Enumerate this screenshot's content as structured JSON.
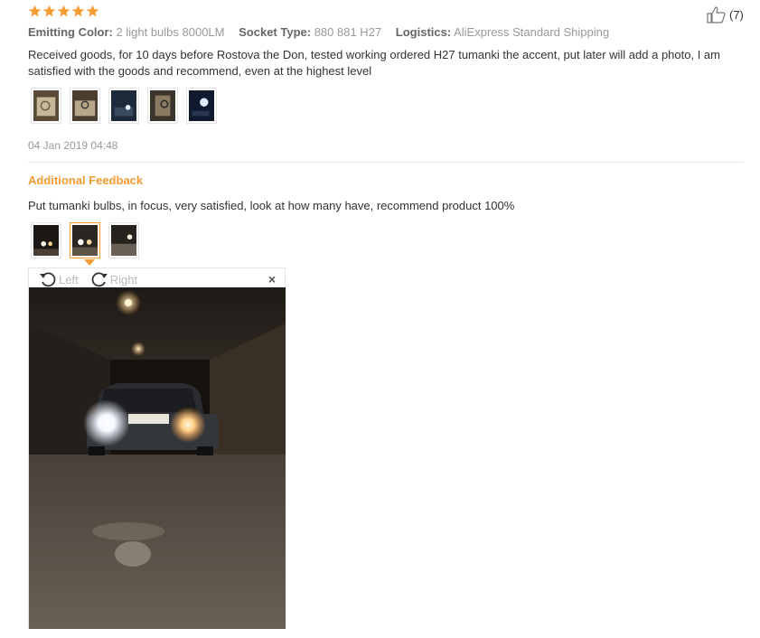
{
  "review": {
    "rating": 5,
    "meta": {
      "emitting_color_label": "Emitting Color:",
      "emitting_color_value": "2 light bulbs 8000LM",
      "socket_type_label": "Socket Type:",
      "socket_type_value": "880 881 H27",
      "logistics_label": "Logistics:",
      "logistics_value": "AliExpress Standard Shipping"
    },
    "likes": "(7)",
    "text": "Received goods, for 10 days before Rostova the Don, tested working ordered H27 tumanki the accent, put later will add a photo, I am satisfied with the goods and recommend, even at the highest level",
    "date": "04 Jan 2019 04:48"
  },
  "additional": {
    "title": "Additional Feedback",
    "text": "Put tumanki bulbs, in focus, very satisfied, look at how many have, recommend product 100%"
  },
  "viewer": {
    "rotate_left": "Left",
    "rotate_right": "Right",
    "close": "×"
  },
  "colors": {
    "accent": "#f49b33",
    "star": "#f49b33",
    "muted": "#999999"
  },
  "icons": [
    "star-icon",
    "thumbs-up-icon",
    "rotate-left-icon",
    "rotate-right-icon",
    "close-icon"
  ]
}
